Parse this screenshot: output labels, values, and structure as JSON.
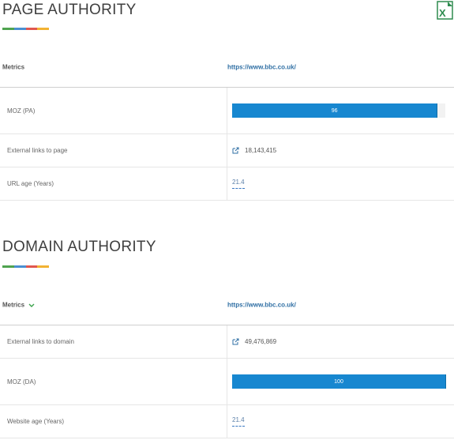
{
  "page_authority": {
    "title": "PAGE AUTHORITY",
    "header": {
      "metrics_label": "Metrics",
      "url": "https://www.bbc.co.uk/"
    },
    "rows": [
      {
        "label": "MOZ (PA)",
        "bar_value": "96",
        "bar_percent": 96
      },
      {
        "label": "External links to page",
        "value": "18,143,415",
        "icon": "external-link-icon"
      },
      {
        "label": "URL age (Years)",
        "value": "21.4"
      }
    ]
  },
  "domain_authority": {
    "title": "DOMAIN AUTHORITY",
    "header": {
      "metrics_label": "Metrics",
      "url": "https://www.bbc.co.uk/"
    },
    "rows": [
      {
        "label": "External links to domain",
        "value": "49,476,869",
        "icon": "external-link-icon"
      },
      {
        "label": "MOZ (DA)",
        "bar_value": "100",
        "bar_percent": 100
      },
      {
        "label": "Website age (Years)",
        "value": "21.4"
      }
    ]
  },
  "colors": {
    "bar": "#1787d0",
    "link": "#2f6fa4",
    "underline": [
      "#4fa34f",
      "#4a8fd1",
      "#e0574f",
      "#f2b233"
    ]
  },
  "icons": {
    "export": "excel-icon",
    "metrics_toggle": "chevron-down-icon"
  }
}
